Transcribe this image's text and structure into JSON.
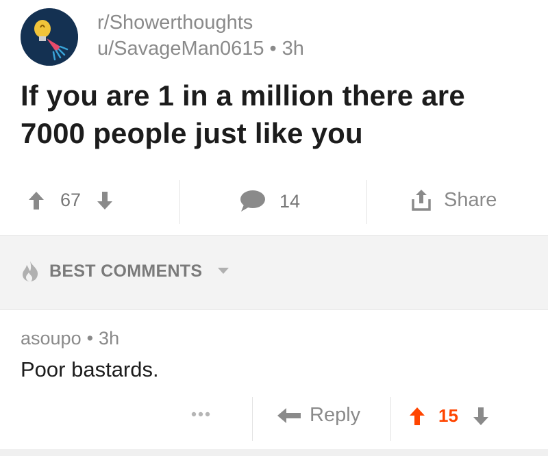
{
  "post": {
    "subreddit": "r/Showerthoughts",
    "author": "u/SavageMan0615",
    "separator": "•",
    "age": "3h",
    "title": "If you are 1 in a million there are 7000 people just like you",
    "avatar_icon": "lightbulb-shower-icon"
  },
  "actions": {
    "upvote_icon": "upvote-arrow-icon",
    "score": "67",
    "downvote_icon": "downvote-arrow-icon",
    "comments_icon": "comment-bubble-icon",
    "comments_count": "14",
    "share_icon": "share-icon",
    "share_label": "Share"
  },
  "sort": {
    "icon": "flame-icon",
    "label": "BEST COMMENTS",
    "caret_icon": "chevron-down-icon"
  },
  "comment": {
    "author": "asoupo",
    "separator": "•",
    "age": "3h",
    "body": "Poor bastards.",
    "more_icon": "more-options-icon",
    "reply_icon": "reply-arrow-icon",
    "reply_label": "Reply",
    "score": "15",
    "vote_state": "upvoted"
  },
  "colors": {
    "upvoted": "#ff4500",
    "muted": "#8a8a8a",
    "avatar_bg": "#143152"
  }
}
